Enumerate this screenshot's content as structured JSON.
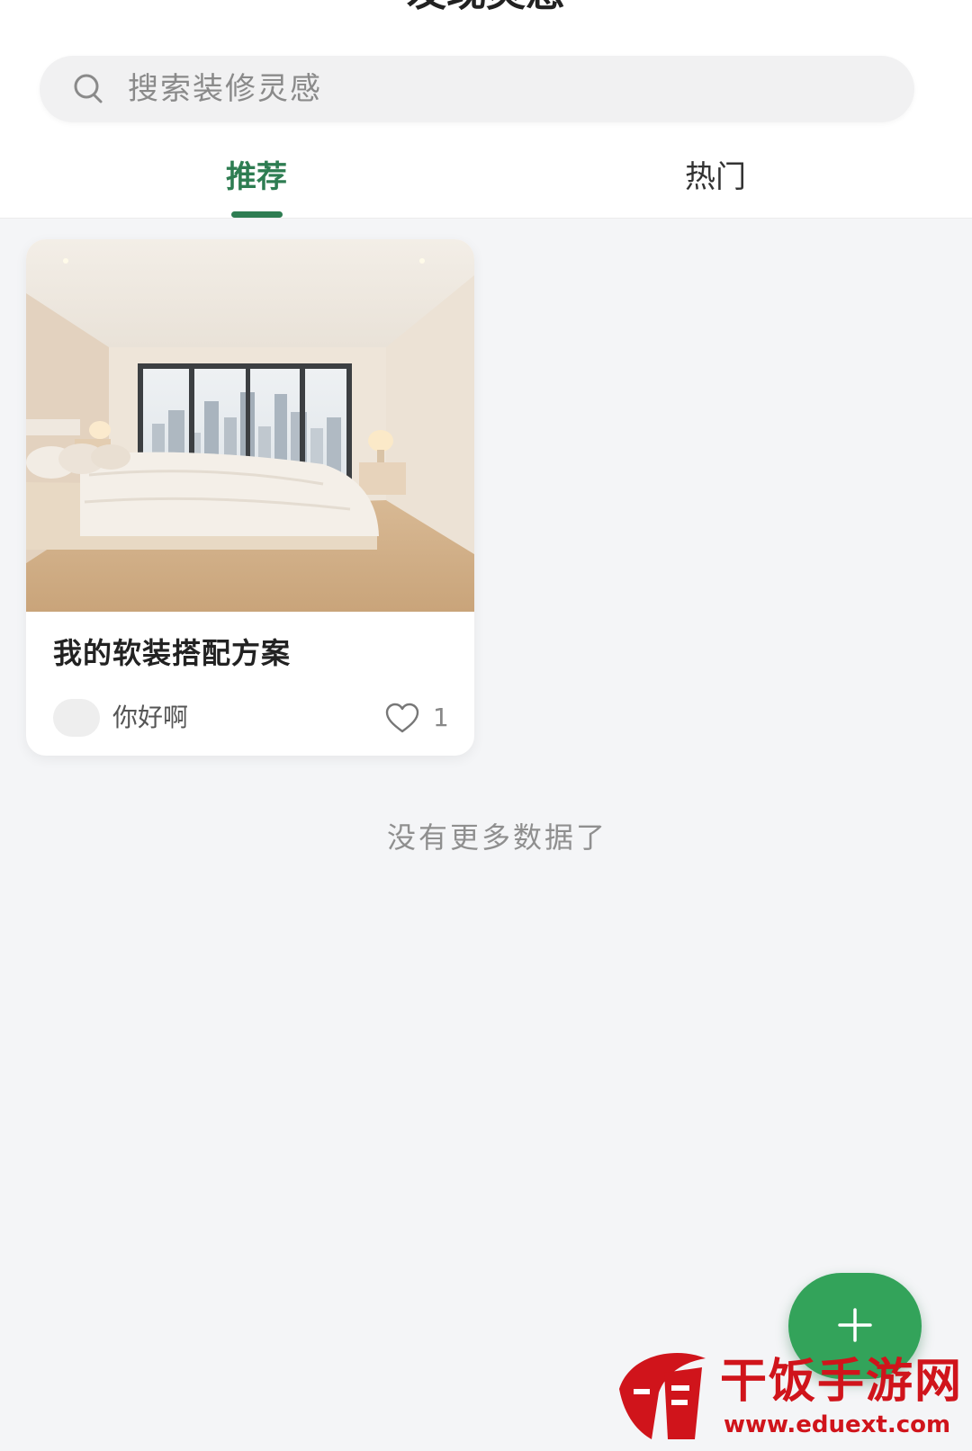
{
  "header": {
    "title": "发现灵感"
  },
  "search": {
    "placeholder": "搜索装修灵感"
  },
  "tabs": [
    {
      "label": "推荐",
      "active": true
    },
    {
      "label": "热门",
      "active": false
    }
  ],
  "feed": {
    "items": [
      {
        "title": "我的软装搭配方案",
        "author": "你好啊",
        "likes": "1"
      }
    ],
    "end_text": "没有更多数据了"
  },
  "fab": {
    "icon": "plus-icon"
  },
  "watermark": {
    "name": "干饭手游网",
    "url": "www.eduext.com"
  },
  "colors": {
    "accent": "#2e7d52",
    "fab": "#33a35a",
    "background": "#f4f5f7",
    "watermark": "#d0141b"
  }
}
